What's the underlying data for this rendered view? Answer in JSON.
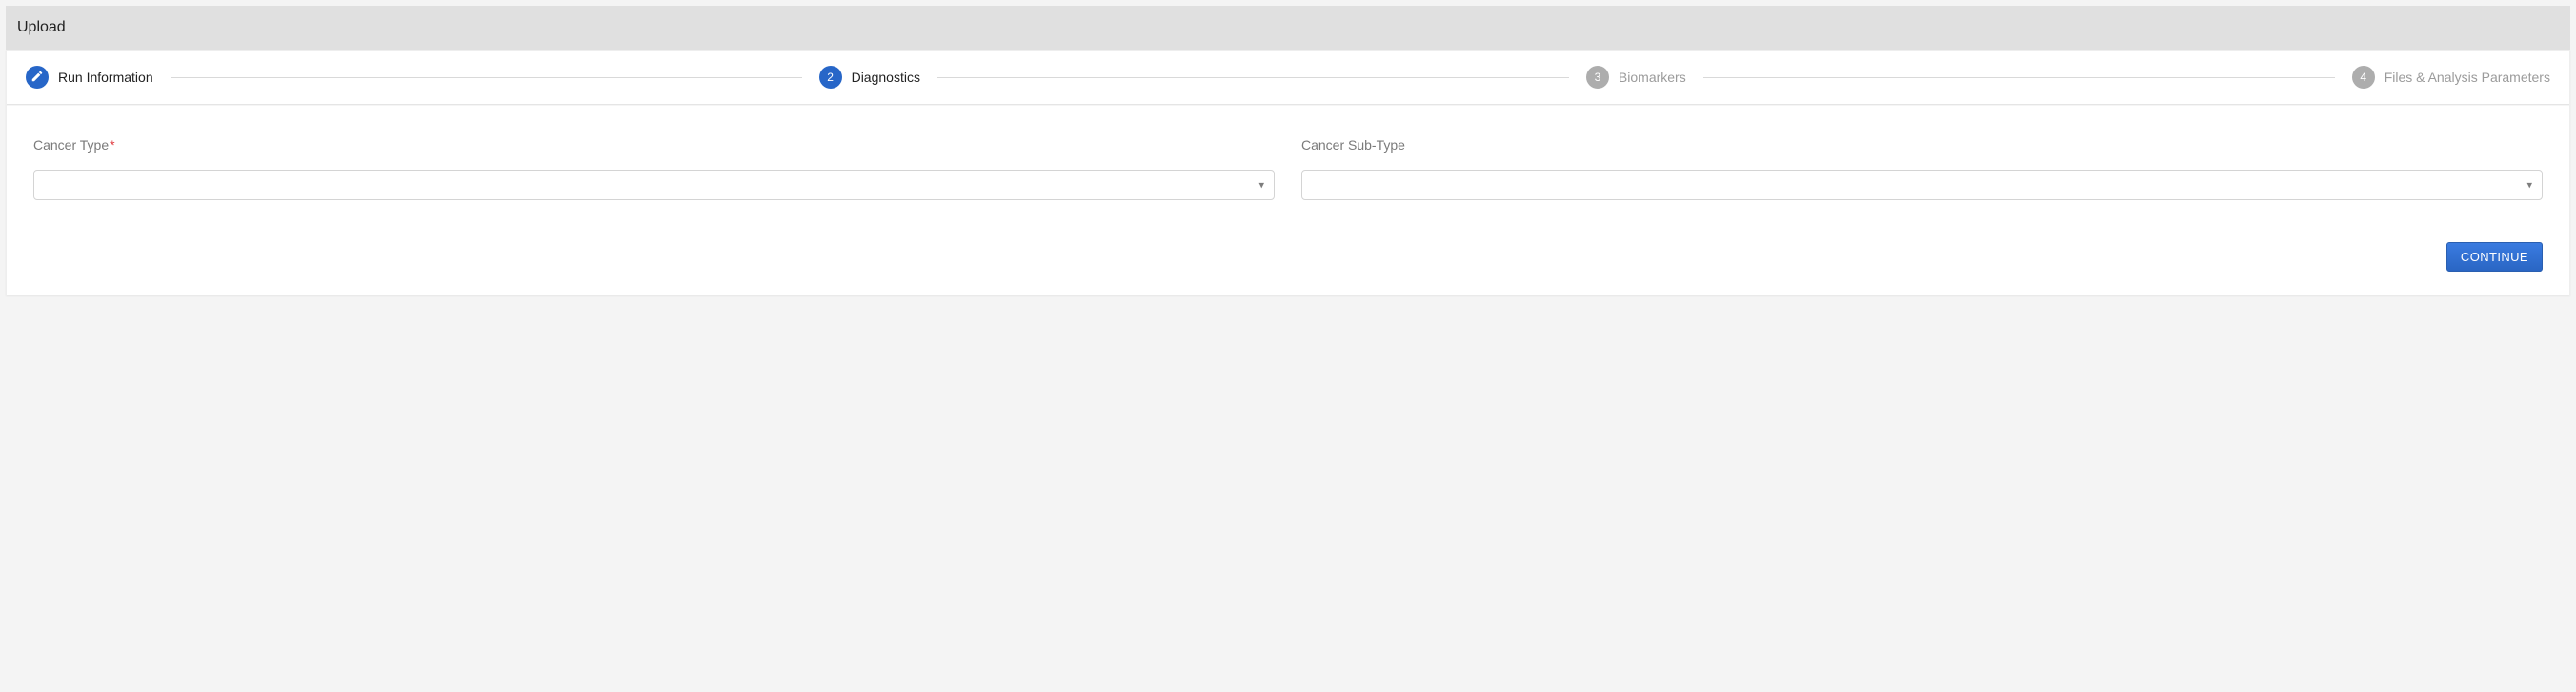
{
  "header": {
    "title": "Upload"
  },
  "stepper": {
    "steps": [
      {
        "label": "Run Information",
        "state": "done",
        "badge": "pencil"
      },
      {
        "label": "Diagnostics",
        "state": "current",
        "badge": "2"
      },
      {
        "label": "Biomarkers",
        "state": "upcoming",
        "badge": "3"
      },
      {
        "label": "Files & Analysis Parameters",
        "state": "upcoming",
        "badge": "4"
      }
    ]
  },
  "form": {
    "cancer_type": {
      "label": "Cancer Type",
      "required_mark": "*",
      "value": ""
    },
    "cancer_subtype": {
      "label": "Cancer Sub-Type",
      "value": ""
    }
  },
  "actions": {
    "continue_label": "CONTINUE"
  }
}
